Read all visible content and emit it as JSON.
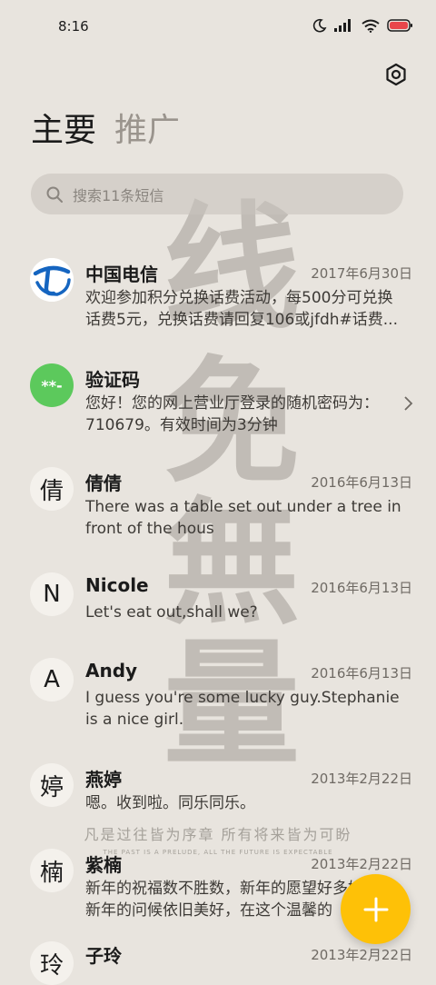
{
  "status_bar": {
    "time": "8:16",
    "icons": [
      "moon-icon",
      "signal-icon",
      "wifi-icon",
      "battery-icon"
    ]
  },
  "tabs": [
    {
      "label": "主要",
      "active": true
    },
    {
      "label": "推广",
      "active": false
    }
  ],
  "search": {
    "placeholder": "搜索11条短信"
  },
  "conversations": [
    {
      "avatar": "",
      "name": "中国电信",
      "date": "2017年6月30日",
      "preview": "欢迎参加积分兑换话费活动，每500分可兑换话费5元，兑换话费请回复106或jfdh#话费..."
    },
    {
      "avatar": "**-",
      "name": "验证码",
      "date": "",
      "preview": "您好！您的网上营业厅登录的随机密码为：710679。有效时间为3分钟"
    },
    {
      "avatar": "倩",
      "name": "倩倩",
      "date": "2016年6月13日",
      "preview": "There was a table set out under a tree in front of the hous"
    },
    {
      "avatar": "N",
      "name": "Nicole",
      "date": "2016年6月13日",
      "preview": "Let's eat out,shall we?"
    },
    {
      "avatar": "A",
      "name": "Andy",
      "date": "2016年6月13日",
      "preview": "I guess you're some lucky guy.Stephanie is a nice girl."
    },
    {
      "avatar": "婷",
      "name": "燕婷",
      "date": "2013年2月22日",
      "preview": "嗯。收到啦。同乐同乐。"
    },
    {
      "avatar": "楠",
      "name": "紫楠",
      "date": "2013年2月22日",
      "preview": "新年的祝福数不胜数，新年的愿望好多好多，新年的问候依旧美好，在这个温馨的"
    },
    {
      "avatar": "玲",
      "name": "子玲",
      "date": "2013年2月22日",
      "preview": ""
    }
  ],
  "wallpaper": {
    "chars": [
      "线",
      "免",
      "無",
      "量"
    ],
    "slogan": "凡是过往皆为序章 所有将来皆为可盼",
    "slogan_en": "THE PAST IS A PRELUDE, ALL THE FUTURE IS EXPECTABLE"
  },
  "colors": {
    "accent": "#fec107",
    "telecom_blue": "#1565c0",
    "verify_green": "#5cc95c"
  }
}
